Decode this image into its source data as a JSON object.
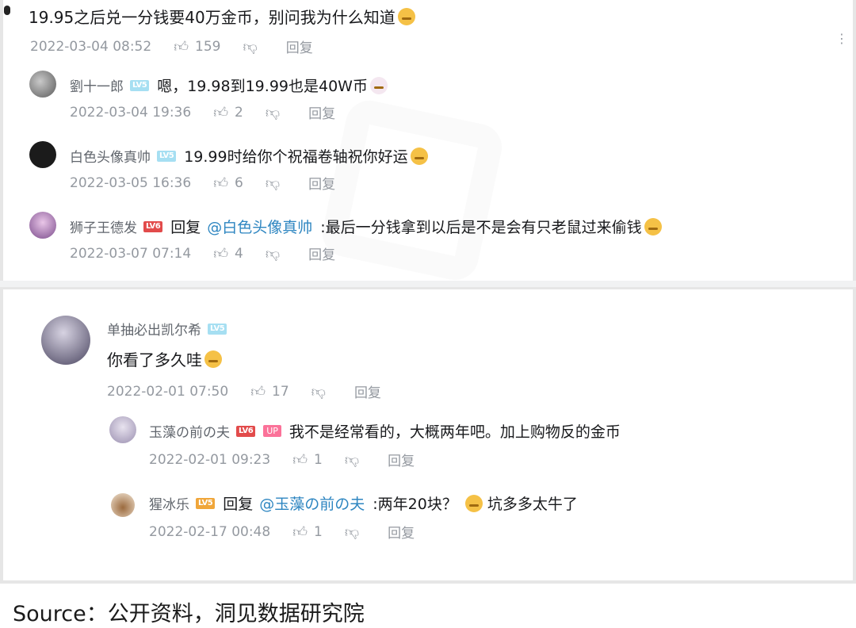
{
  "thread_top": {
    "root": {
      "text": "19.95之后兑一分钱要40万金币，别问我为什么知道",
      "date": "2022-03-04 08:52",
      "likes": "159",
      "reply_label": "回复"
    },
    "replies": [
      {
        "username": "劉十一郎",
        "level": "LV5",
        "text": "嗯，19.98到19.99也是40W币",
        "date": "2022-03-04 19:36",
        "likes": "2",
        "reply_label": "回复"
      },
      {
        "username": "白色头像真帅",
        "level": "LV5",
        "text": "19.99时给你个祝福卷轴祝你好运",
        "date": "2022-03-05 16:36",
        "likes": "6",
        "reply_label": "回复"
      },
      {
        "username": "狮子王德发",
        "level": "LV6",
        "reply_prefix": "回复",
        "mention": "@白色头像真帅",
        "text": ":最后一分钱拿到以后是不是会有只老鼠过来偷钱",
        "date": "2022-03-07 07:14",
        "likes": "4",
        "reply_label": "回复"
      }
    ]
  },
  "thread_bottom": {
    "root": {
      "username": "单抽必出凯尔希",
      "level": "LV5",
      "text": "你看了多久哇",
      "date": "2022-02-01 07:50",
      "likes": "17",
      "reply_label": "回复"
    },
    "replies": [
      {
        "username": "玉藻の前の夫",
        "level": "LV6",
        "up_tag": "UP",
        "text": "我不是经常看的，大概两年吧。加上购物反的金币",
        "date": "2022-02-01 09:23",
        "likes": "1",
        "reply_label": "回复"
      },
      {
        "username": "猩冰乐",
        "level": "LV5",
        "reply_prefix": "回复",
        "mention": "@玉藻の前の夫",
        "text": ":两年20块？",
        "text2": "坑多多太牛了",
        "date": "2022-02-17 00:48",
        "likes": "1",
        "reply_label": "回复"
      }
    ]
  },
  "source_note": "Source：公开资料，洞见数据研究院",
  "colors": {
    "level_blue": "#a6dff2",
    "level_red": "#e24b4b",
    "level_orange": "#f0a63a",
    "up_pink": "#fb7299",
    "mention_blue": "#2e86c1",
    "meta_gray": "#9499a0"
  },
  "icons": [
    "like-icon",
    "dislike-icon",
    "more-icon",
    "emoji-icon"
  ]
}
